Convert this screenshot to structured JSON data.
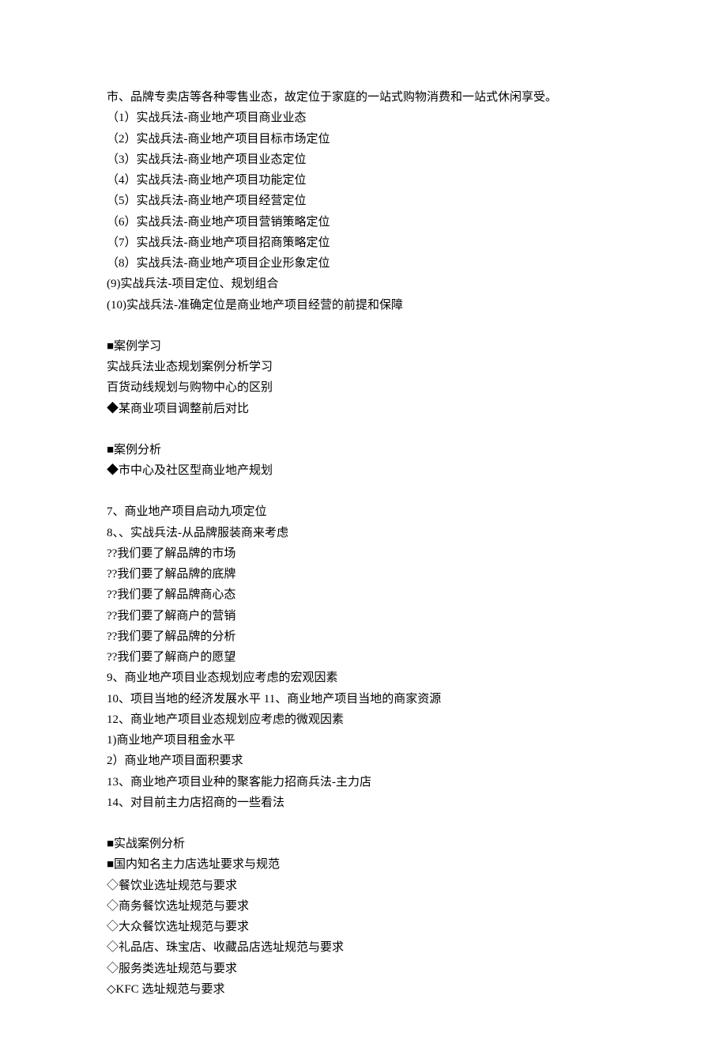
{
  "lines": [
    "市、品牌专卖店等各种零售业态，故定位于家庭的一站式购物消费和一站式休闲享受。",
    "（1）实战兵法-商业地产项目商业业态",
    "（2）实战兵法-商业地产项目目标市场定位",
    "（3）实战兵法-商业地产项目业态定位",
    "（4）实战兵法-商业地产项目功能定位",
    "（5）实战兵法-商业地产项目经营定位",
    "（6）实战兵法-商业地产项目营销策略定位",
    "（7）实战兵法-商业地产项目招商策略定位",
    "（8）实战兵法-商业地产项目企业形象定位",
    "(9)实战兵法-项目定位、规划组合",
    "(10)实战兵法-准确定位是商业地产项目经营的前提和保障",
    "",
    "■案例学习",
    "实战兵法业态规划案例分析学习",
    "百货动线规划与购物中心的区别",
    "◆某商业项目调整前后对比",
    "",
    "■案例分析",
    "◆市中心及社区型商业地产规划",
    "",
    "7、商业地产项目启动九项定位",
    "8、、实战兵法-从品牌服装商来考虑",
    "??我们要了解品牌的市场",
    "??我们要了解品牌的底牌",
    "??我们要了解品牌商心态",
    "??我们要了解商户的营销",
    "??我们要了解品牌的分析",
    "??我们要了解商户的愿望",
    "9、商业地产项目业态规划应考虑的宏观因素",
    "10、项目当地的经济发展水平 11、商业地产项目当地的商家资源",
    "12、商业地产项目业态规划应考虑的微观因素",
    "1)商业地产项目租金水平",
    "2）商业地产项目面积要求",
    "13、商业地产项目业种的聚客能力招商兵法-主力店",
    "14、对目前主力店招商的一些看法",
    "",
    "■实战案例分析",
    "■国内知名主力店选址要求与规范",
    "◇餐饮业选址规范与要求",
    "◇商务餐饮选址规范与要求",
    "◇大众餐饮选址规范与要求",
    "◇礼品店、珠宝店、收藏品店选址规范与要求",
    "◇服务类选址规范与要求",
    "◇KFC 选址规范与要求"
  ]
}
